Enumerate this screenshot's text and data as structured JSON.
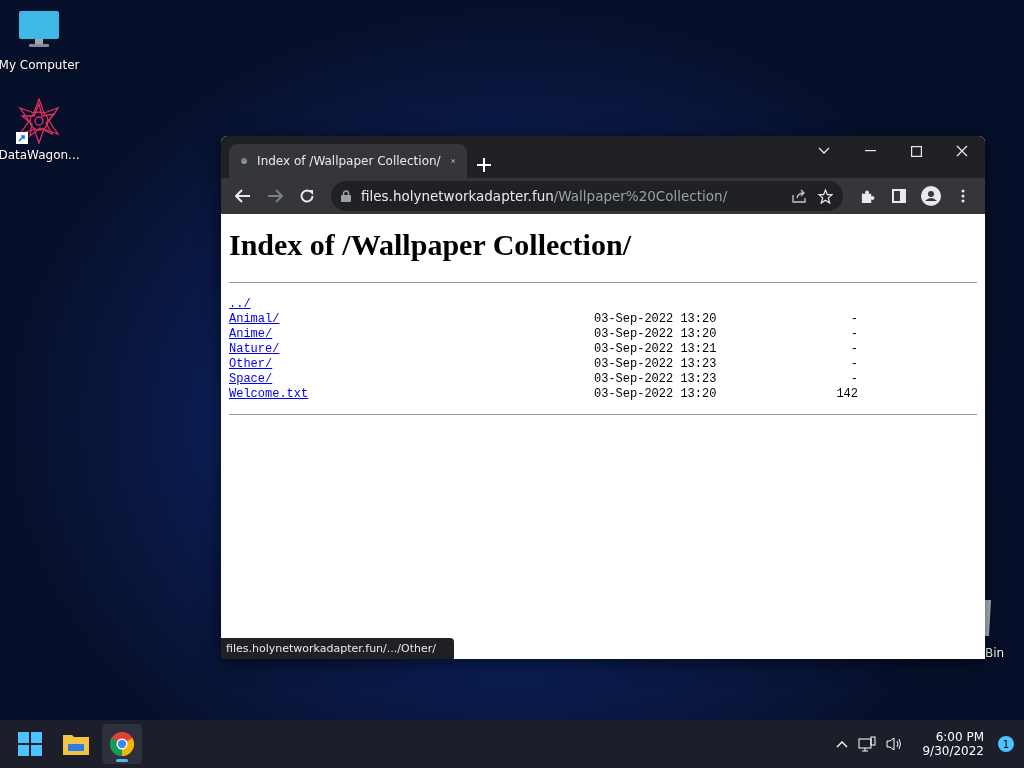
{
  "desktop_icons": [
    {
      "kind": "computer",
      "label": "My Computer",
      "shortcut": false
    },
    {
      "kind": "mandala",
      "label": "DataWagon...",
      "shortcut": true
    }
  ],
  "recycle_bin": {
    "label": "Bin"
  },
  "browser": {
    "tabs": [
      {
        "title": "Index of /Wallpaper Collection/",
        "selected": true
      }
    ],
    "address": {
      "host": "files.holynetworkadapter.fun",
      "path": "/Wallpaper%20Collection/"
    },
    "page": {
      "heading": "Index of /Wallpaper Collection/",
      "entries": [
        {
          "name": "../"
        },
        {
          "name": "Animal/",
          "date": "03-Sep-2022 13:20",
          "size": "-"
        },
        {
          "name": "Anime/",
          "date": "03-Sep-2022 13:20",
          "size": "-"
        },
        {
          "name": "Nature/",
          "date": "03-Sep-2022 13:21",
          "size": "-"
        },
        {
          "name": "Other/",
          "date": "03-Sep-2022 13:23",
          "size": "-"
        },
        {
          "name": "Space/",
          "date": "03-Sep-2022 13:23",
          "size": "-"
        },
        {
          "name": "Welcome.txt",
          "date": "03-Sep-2022 13:20",
          "size": "142"
        }
      ]
    },
    "status_url": "files.holynetworkadapter.fun/.../Other/"
  },
  "taskbar": {
    "apps": [
      {
        "kind": "start",
        "running": false
      },
      {
        "kind": "explorer",
        "running": false
      },
      {
        "kind": "chrome",
        "running": true
      }
    ],
    "time": "6:00 PM",
    "date": "9/30/2022",
    "notifications": "1"
  }
}
